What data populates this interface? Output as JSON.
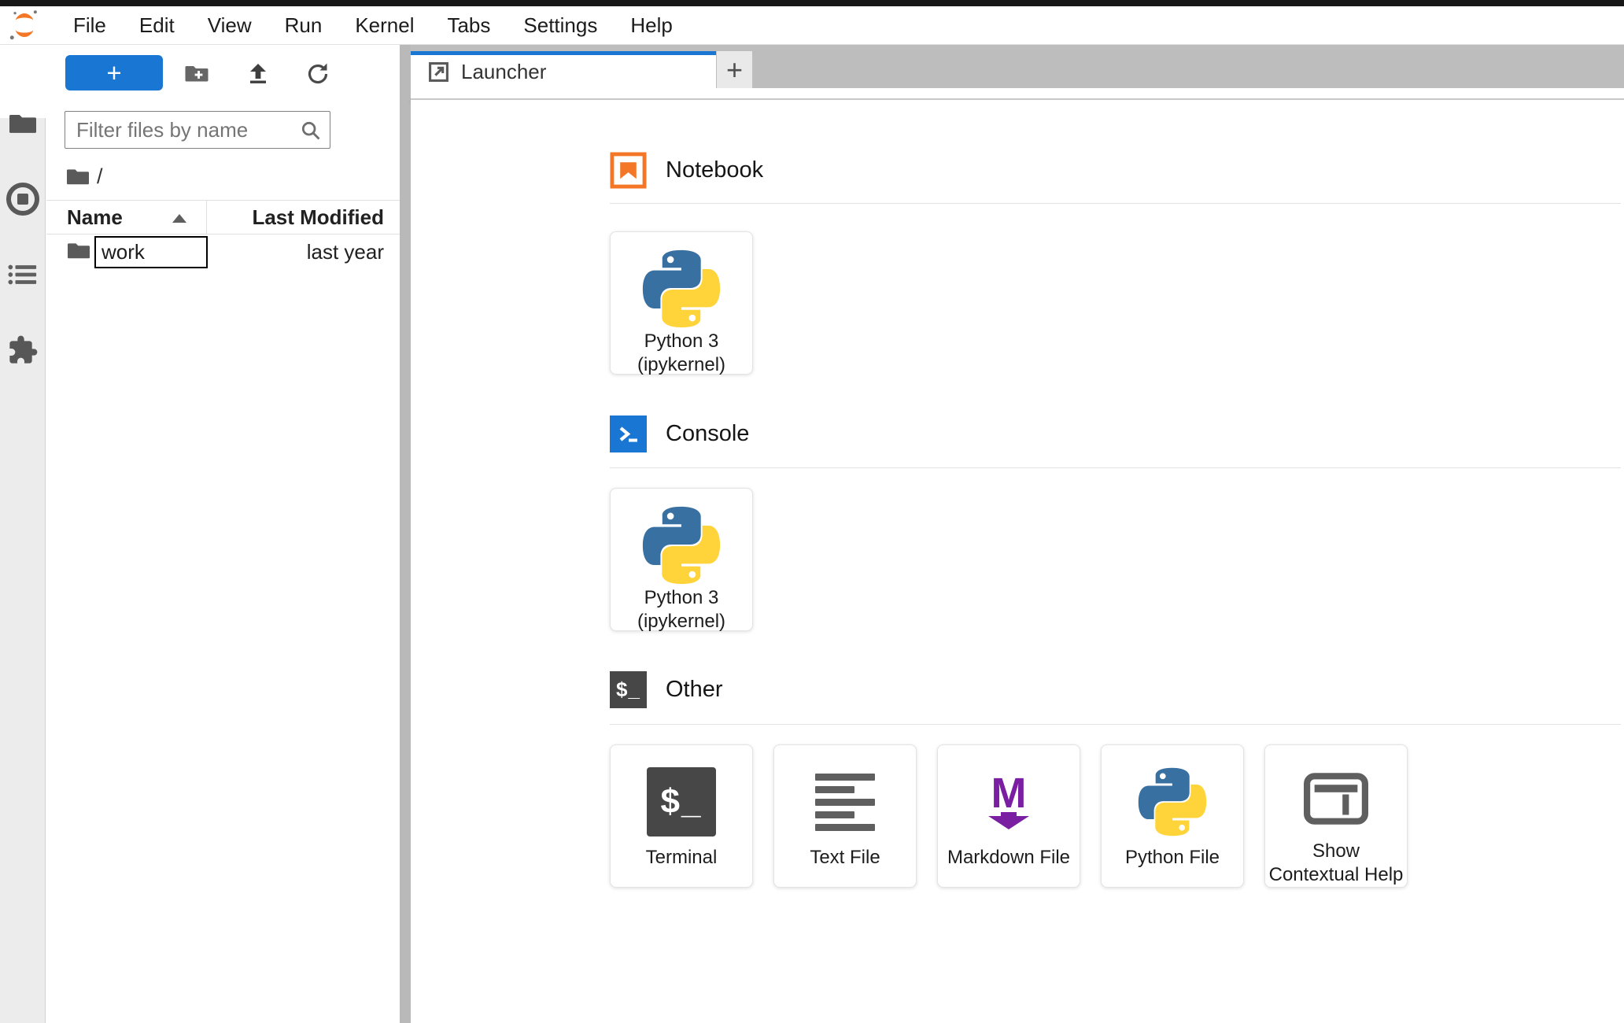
{
  "app": "JupyterLab",
  "menu": {
    "items": [
      "File",
      "Edit",
      "View",
      "Run",
      "Kernel",
      "Tabs",
      "Settings",
      "Help"
    ]
  },
  "activity_bar": {
    "items": [
      {
        "id": "file-browser",
        "icon": "folder-icon",
        "active": true
      },
      {
        "id": "running-kernels",
        "icon": "stop-circle-icon",
        "active": false
      },
      {
        "id": "table-of-contents",
        "icon": "list-icon",
        "active": false
      },
      {
        "id": "extension-manager",
        "icon": "puzzle-icon",
        "active": false
      }
    ]
  },
  "file_browser": {
    "new_launcher_button": "+",
    "toolbar_icons": [
      "new-folder-icon",
      "upload-icon",
      "refresh-icon"
    ],
    "filter_placeholder": "Filter files by name",
    "breadcrumb_root": "/",
    "header": {
      "name": "Name",
      "modified": "Last Modified",
      "sort": "ascending"
    },
    "rows": [
      {
        "name": "work",
        "modified": "last year",
        "renaming": true
      }
    ]
  },
  "tab_bar": {
    "tabs": [
      {
        "label": "Launcher",
        "active": true
      }
    ],
    "add_button": "+"
  },
  "launcher": {
    "sections": [
      {
        "title": "Notebook",
        "icon": "notebook-icon",
        "cards": [
          {
            "lines": [
              "Python 3",
              "(ipykernel)"
            ],
            "icon": "python-icon"
          }
        ]
      },
      {
        "title": "Console",
        "icon": "console-icon",
        "cards": [
          {
            "lines": [
              "Python 3",
              "(ipykernel)"
            ],
            "icon": "python-icon"
          }
        ]
      },
      {
        "title": "Other",
        "icon": "terminal-icon",
        "cards": [
          {
            "lines": [
              "Terminal"
            ],
            "icon": "terminal-icon"
          },
          {
            "lines": [
              "Text File"
            ],
            "icon": "text-file-icon"
          },
          {
            "lines": [
              "Markdown File"
            ],
            "icon": "markdown-file-icon"
          },
          {
            "lines": [
              "Python File"
            ],
            "icon": "python-icon"
          },
          {
            "lines": [
              "Show",
              "Contextual Help"
            ],
            "icon": "contextual-help-icon"
          }
        ]
      }
    ]
  },
  "glyphs": {
    "terminal": "$_",
    "other_section": "$_",
    "markdown_m": "M"
  },
  "colors": {
    "jupyter_orange": "#F37726",
    "accent_blue": "#1976D2",
    "markdown_purple": "#7B1FA2",
    "terminal_gray": "#474747",
    "tab_bar_gray": "#BDBDBD",
    "top_strip": "#171717"
  }
}
